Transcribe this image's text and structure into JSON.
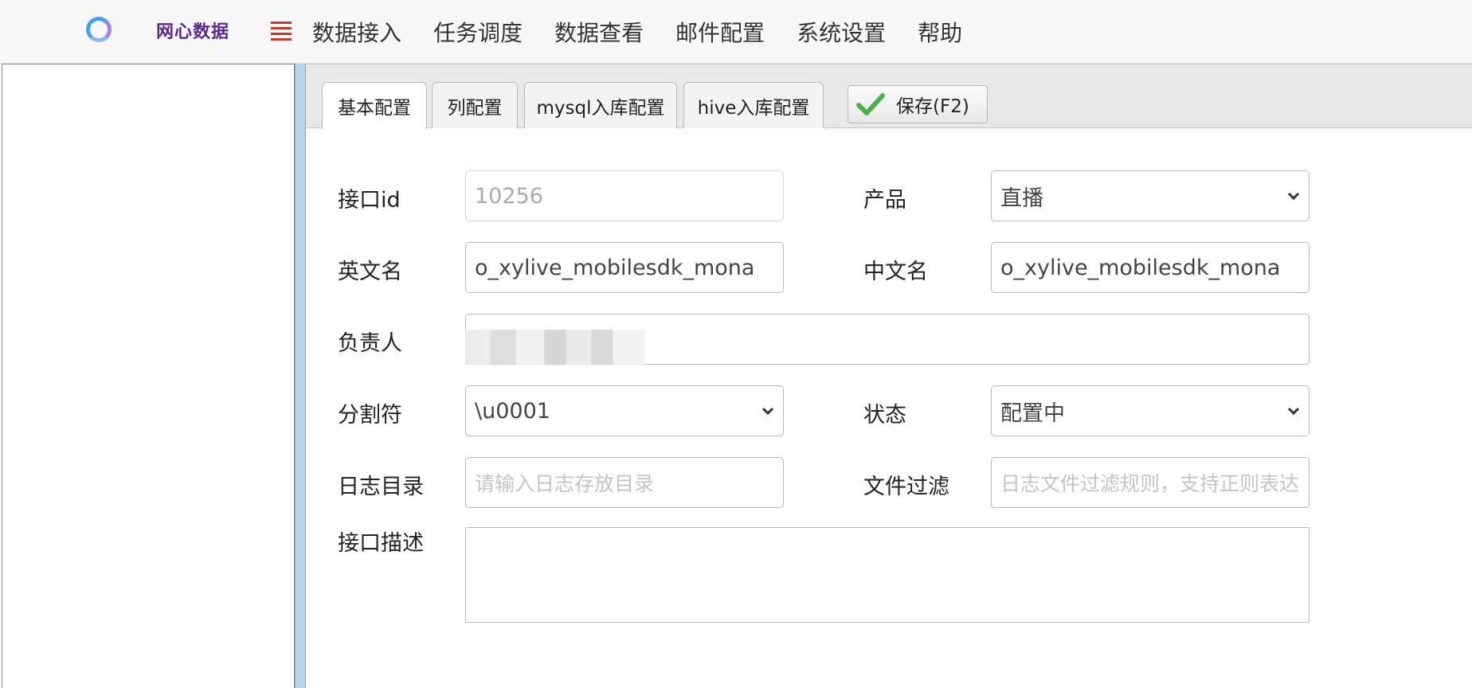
{
  "navbar": {
    "brand": "网心数据",
    "items": [
      "数据接入",
      "任务调度",
      "数据查看",
      "邮件配置",
      "系统设置",
      "帮助"
    ]
  },
  "tabs": {
    "items": [
      "基本配置",
      "列配置",
      "mysql入库配置",
      "hive入库配置"
    ],
    "active": "基本配置",
    "save_label": "保存(F2)"
  },
  "form": {
    "interface_id": {
      "label": "接口id",
      "value": "10256"
    },
    "product": {
      "label": "产品",
      "value": "直播"
    },
    "english_name": {
      "label": "英文名",
      "value": "o_xylive_mobilesdk_mona"
    },
    "chinese_name": {
      "label": "中文名",
      "value": "o_xylive_mobilesdk_mona"
    },
    "owner": {
      "label": "负责人",
      "value": ""
    },
    "delimiter": {
      "label": "分割符",
      "value": "\\u0001"
    },
    "status": {
      "label": "状态",
      "value": "配置中"
    },
    "log_dir": {
      "label": "日志目录",
      "placeholder": "请输入日志存放目录"
    },
    "file_filter": {
      "label": "文件过滤",
      "placeholder": "日志文件过滤规则，支持正则表达式"
    },
    "description": {
      "label": "接口描述",
      "value": ""
    }
  },
  "colors": {
    "brand": "#5a2a8a",
    "menu_icon": "#c0392b",
    "check": "#4caf50",
    "splitter": "#b9d3ea"
  }
}
